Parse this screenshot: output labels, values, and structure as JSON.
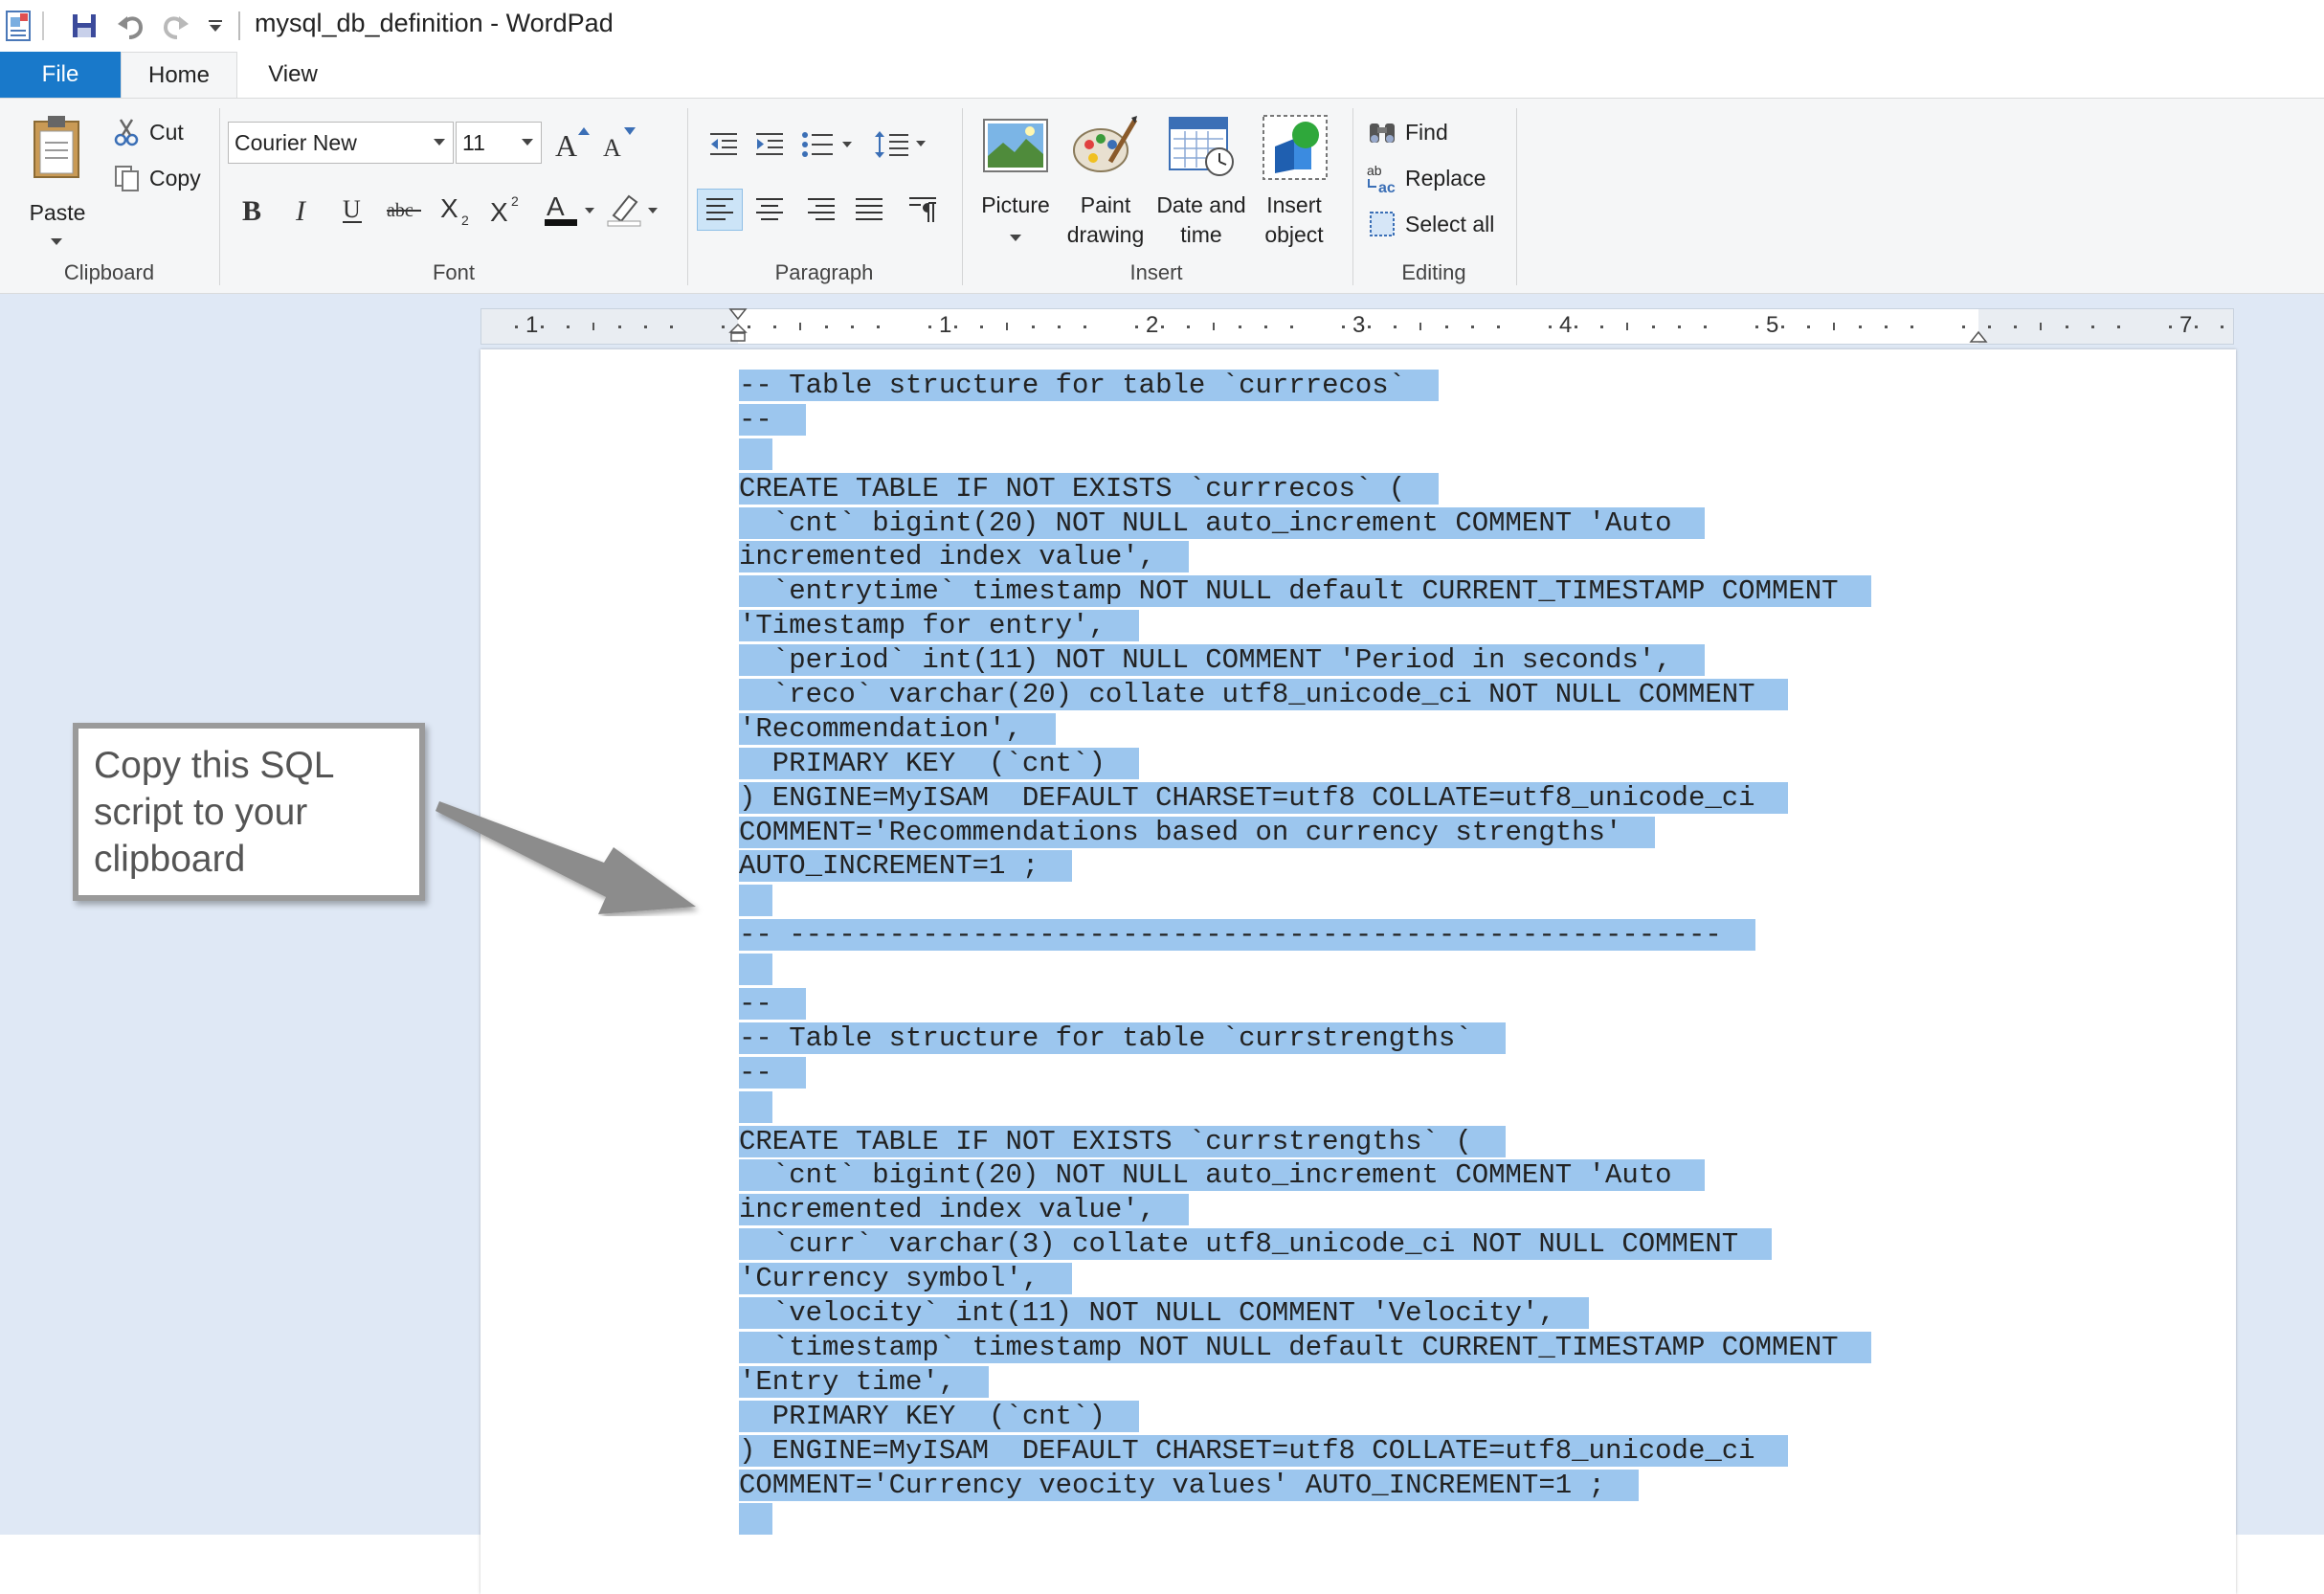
{
  "window": {
    "title": "mysql_db_definition - WordPad"
  },
  "quick_access": {
    "icons": [
      "wordpad-app-icon",
      "save-icon",
      "undo-icon",
      "redo-icon",
      "customize-dropdown-icon"
    ]
  },
  "tabs": [
    {
      "label": "File"
    },
    {
      "label": "Home"
    },
    {
      "label": "View"
    }
  ],
  "ribbon": {
    "clipboard": {
      "paste_label": "Paste",
      "cut_label": "Cut",
      "copy_label": "Copy",
      "group_label": "Clipboard"
    },
    "font": {
      "family": "Courier New",
      "size": "11",
      "group_label": "Font"
    },
    "paragraph": {
      "group_label": "Paragraph"
    },
    "insert": {
      "picture_label": "Picture",
      "paint_label_1": "Paint",
      "paint_label_2": "drawing",
      "datetime_label_1": "Date and",
      "datetime_label_2": "time",
      "object_label_1": "Insert",
      "object_label_2": "object",
      "group_label": "Insert"
    },
    "editing": {
      "find_label": "Find",
      "replace_label": "Replace",
      "select_all_label": "Select all",
      "group_label": "Editing"
    }
  },
  "ruler": {
    "numbers": [
      "1",
      "1",
      "2",
      "3",
      "4",
      "5",
      "7"
    ]
  },
  "callout": {
    "line1": "Copy this SQL",
    "line2": "script to your",
    "line3": "clipboard"
  },
  "document": {
    "lines": [
      "-- Table structure for table `currrecos`",
      "--",
      "",
      "CREATE TABLE IF NOT EXISTS `currrecos` (",
      "  `cnt` bigint(20) NOT NULL auto_increment COMMENT 'Auto",
      "incremented index value',",
      "  `entrytime` timestamp NOT NULL default CURRENT_TIMESTAMP COMMENT",
      "'Timestamp for entry',",
      "  `period` int(11) NOT NULL COMMENT 'Period in seconds',",
      "  `reco` varchar(20) collate utf8_unicode_ci NOT NULL COMMENT",
      "'Recommendation',",
      "  PRIMARY KEY  (`cnt`)",
      ") ENGINE=MyISAM  DEFAULT CHARSET=utf8 COLLATE=utf8_unicode_ci",
      "COMMENT='Recommendations based on currency strengths'",
      "AUTO_INCREMENT=1 ;",
      "",
      "-- --------------------------------------------------------",
      "",
      "--",
      "-- Table structure for table `currstrengths`",
      "--",
      "",
      "CREATE TABLE IF NOT EXISTS `currstrengths` (",
      "  `cnt` bigint(20) NOT NULL auto_increment COMMENT 'Auto",
      "incremented index value',",
      "  `curr` varchar(3) collate utf8_unicode_ci NOT NULL COMMENT",
      "'Currency symbol',",
      "  `velocity` int(11) NOT NULL COMMENT 'Velocity',",
      "  `timestamp` timestamp NOT NULL default CURRENT_TIMESTAMP COMMENT",
      "'Entry time',",
      "  PRIMARY KEY  (`cnt`)",
      ") ENGINE=MyISAM  DEFAULT CHARSET=utf8 COLLATE=utf8_unicode_ci",
      "COMMENT='Currency veocity values' AUTO_INCREMENT=1 ;",
      ""
    ]
  },
  "colors": {
    "file_tab": "#1979ca",
    "selection": "#9cc6ee",
    "workspace": "#dfe8f5",
    "ribbon": "#f5f6f7"
  }
}
